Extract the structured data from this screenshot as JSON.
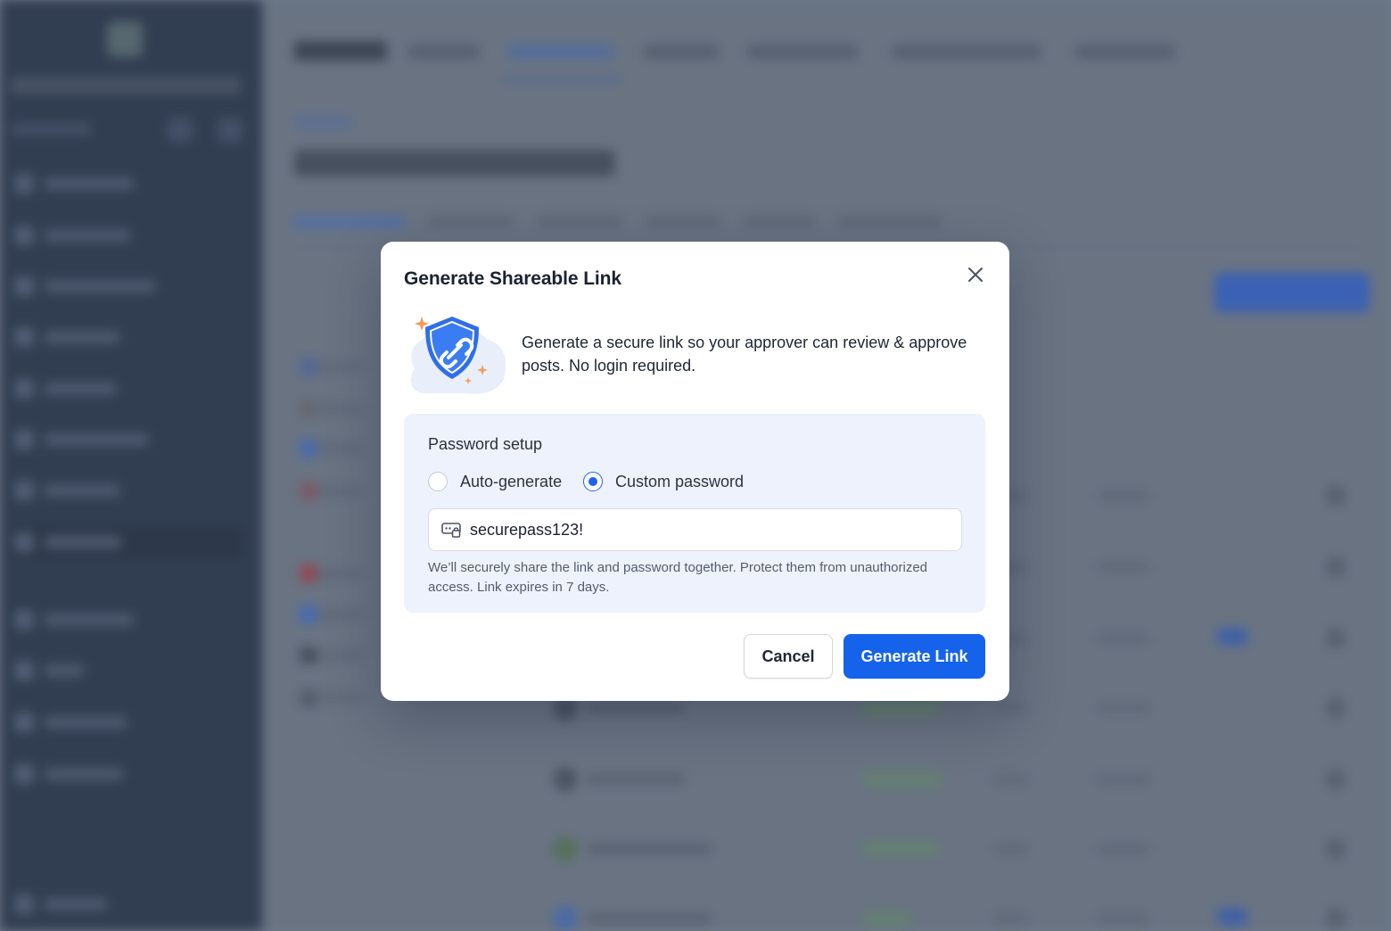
{
  "modal": {
    "title": "Generate Shareable Link",
    "description": "Generate a secure link so your approver can review & approve posts. No login required.",
    "close_icon": "close-icon",
    "illustration_icon": "shield-link-icon",
    "password_setup": {
      "label": "Password setup",
      "options": [
        {
          "label": "Auto-generate",
          "selected": false
        },
        {
          "label": "Custom password",
          "selected": true
        }
      ],
      "password_value": "securepass123!",
      "field_icon": "password-key-icon",
      "help_text": "We’ll securely share the link and password together. Protect them from unauthorized access. Link expires in 7 days."
    },
    "buttons": {
      "cancel": "Cancel",
      "generate": "Generate Link"
    }
  },
  "colors": {
    "primary": "#1463ea",
    "panel_bg": "#eef2fd",
    "sidebar_bg": "#2f3c50"
  }
}
